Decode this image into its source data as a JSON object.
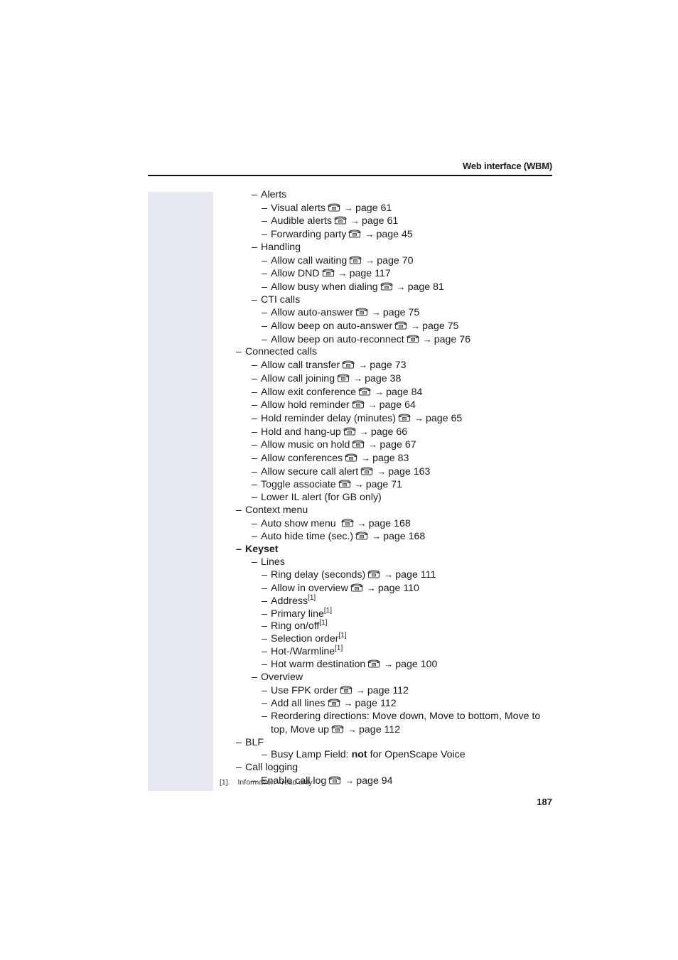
{
  "header": {
    "title": "Web interface (WBM)"
  },
  "icons": {
    "phone": "phone-icon",
    "arrow": "→"
  },
  "items": [
    {
      "level": 2,
      "text": "Alerts"
    },
    {
      "level": 3,
      "text": "Visual alerts",
      "ref": "page 61"
    },
    {
      "level": 3,
      "text": "Audible alerts",
      "ref": "page 61"
    },
    {
      "level": 3,
      "text": "Forwarding party",
      "ref": "page 45"
    },
    {
      "level": 2,
      "text": "Handling"
    },
    {
      "level": 3,
      "text": "Allow call waiting",
      "ref": "page 70"
    },
    {
      "level": 3,
      "text": "Allow DND",
      "ref": "page 117"
    },
    {
      "level": 3,
      "text": "Allow busy when dialing",
      "ref": "page 81"
    },
    {
      "level": 2,
      "text": "CTI calls"
    },
    {
      "level": 3,
      "text": "Allow auto-answer",
      "ref": "page 75"
    },
    {
      "level": 3,
      "text": "Allow beep on auto-answer",
      "ref": "page 75"
    },
    {
      "level": 3,
      "text": "Allow beep on auto-reconnect",
      "ref": "page 76"
    },
    {
      "level": 1,
      "text": "Connected calls"
    },
    {
      "level": 2,
      "text": "Allow call transfer",
      "ref": "page 73"
    },
    {
      "level": 2,
      "text": "Allow call joining",
      "ref": "page 38"
    },
    {
      "level": 2,
      "text": "Allow exit conference",
      "ref": "page 84"
    },
    {
      "level": 2,
      "text": "Allow hold reminder",
      "ref": "page 64"
    },
    {
      "level": 2,
      "text": "Hold reminder delay (minutes)",
      "ref": "page 65"
    },
    {
      "level": 2,
      "text": "Hold and hang-up",
      "ref": "page 66"
    },
    {
      "level": 2,
      "text": "Allow music on hold",
      "ref": "page 67"
    },
    {
      "level": 2,
      "text": "Allow conferences",
      "ref": "page 83"
    },
    {
      "level": 2,
      "text": "Allow secure call alert",
      "ref": "page 163"
    },
    {
      "level": 2,
      "text": "Toggle associate",
      "ref": "page 71"
    },
    {
      "level": 2,
      "text": "Lower IL alert (for GB only)"
    },
    {
      "level": 1,
      "text": "Context menu"
    },
    {
      "level": 2,
      "text": "Auto show menu ",
      "ref": "page 168"
    },
    {
      "level": 2,
      "text": "Auto hide time (sec.)",
      "ref": "page 168"
    },
    {
      "level": 1,
      "text": "Keyset",
      "bold": true
    },
    {
      "level": 2,
      "text": "Lines"
    },
    {
      "level": 3,
      "text": "Ring delay (seconds)",
      "ref": "page 111"
    },
    {
      "level": 3,
      "text": "Allow in overview",
      "ref": "page 110"
    },
    {
      "level": 3,
      "text": "Address",
      "footnote": "[1]"
    },
    {
      "level": 3,
      "text": "Primary line",
      "footnote": "[1]"
    },
    {
      "level": 3,
      "text": "Ring on/off",
      "footnote": "[1]"
    },
    {
      "level": 3,
      "text": "Selection order",
      "footnote": "[1]"
    },
    {
      "level": 3,
      "text": "Hot-/Warmline",
      "footnote": "[1]"
    },
    {
      "level": 3,
      "text": "Hot warm destination",
      "ref": "page 100"
    },
    {
      "level": 2,
      "text": "Overview"
    },
    {
      "level": 3,
      "text": "Use FPK order",
      "ref": "page 112"
    },
    {
      "level": 3,
      "text": "Add all lines",
      "ref": "page 112"
    },
    {
      "level": 3,
      "text": "Reordering directions: Move down, Move to bottom, Move to top, Move up",
      "ref": "page 112",
      "wrap": true
    },
    {
      "level": 1,
      "text": "BLF"
    },
    {
      "level": 3,
      "text": "Busy Lamp Field: ",
      "bold_part": "not",
      "text_after": " for OpenScape Voice"
    },
    {
      "level": 1,
      "text": "Call logging"
    },
    {
      "level": 2,
      "text": "Enable call log",
      "ref": "page 94"
    }
  ],
  "footnote": {
    "mark": "[1].",
    "text": "Information - read only"
  },
  "page_number": "187"
}
